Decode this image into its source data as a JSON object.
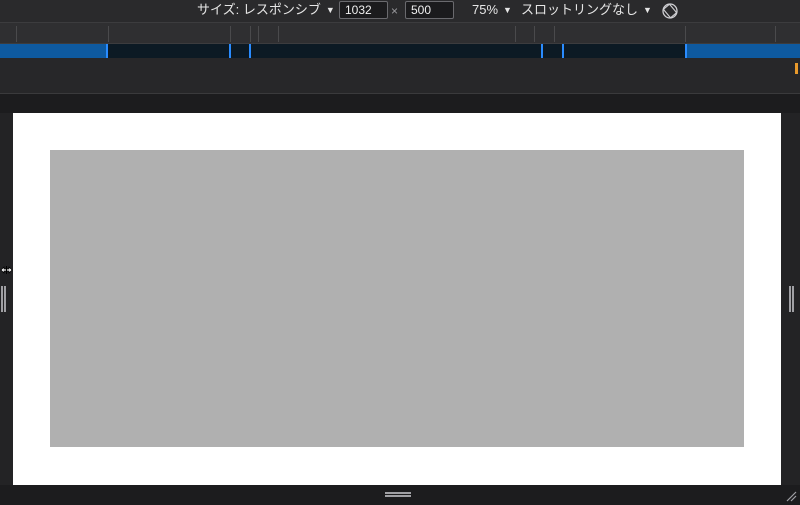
{
  "toolbar": {
    "size_label": "サイズ: レスポンシブ",
    "width_value": "1032",
    "height_value": "500",
    "times_symbol": "×",
    "zoom_label": "75%",
    "throttle_label": "スロットリングなし",
    "caret": "▼",
    "rotate_icon": "rotate-icon"
  },
  "colors": {
    "breakpoint_accent": "#2a8cff",
    "breakpoint_highlight": "#0e5aa0",
    "viewport_bg": "#ffffff",
    "content_box": "#b0b0b0",
    "marker_orange": "#e89a2c"
  }
}
